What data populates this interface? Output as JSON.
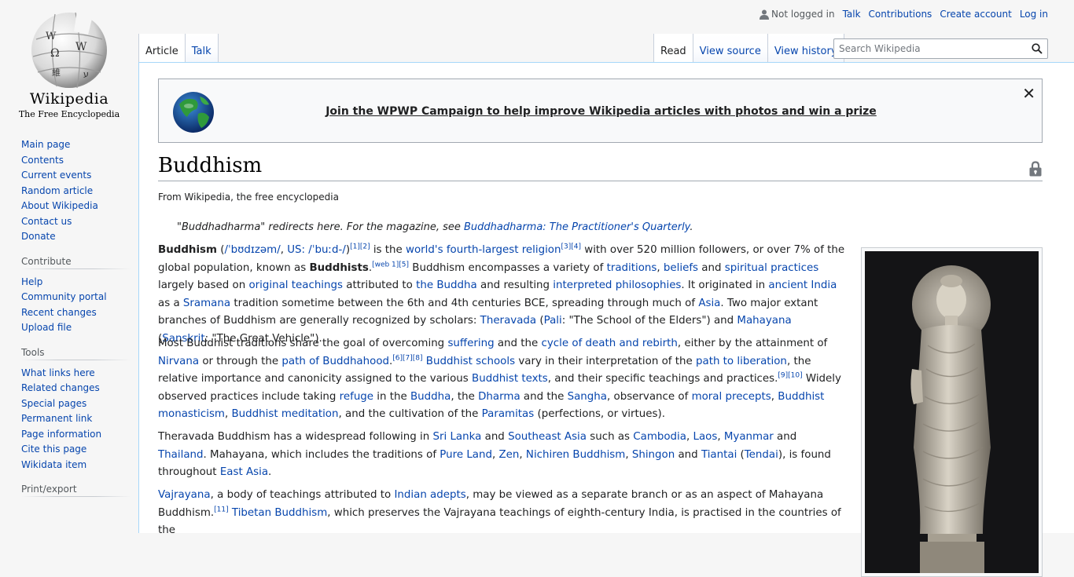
{
  "logo": {
    "wordmark": "Wikipedia",
    "tagline": "The Free Encyclopedia"
  },
  "personal": {
    "not_logged_in": "Not logged in",
    "talk": "Talk",
    "contributions": "Contributions",
    "create_account": "Create account",
    "log_in": "Log in"
  },
  "tabs": {
    "article": "Article",
    "talk": "Talk",
    "read": "Read",
    "view_source": "View source",
    "view_history": "View history"
  },
  "search": {
    "placeholder": "Search Wikipedia"
  },
  "sidebar": {
    "nav": [
      "Main page",
      "Contents",
      "Current events",
      "Random article",
      "About Wikipedia",
      "Contact us",
      "Donate"
    ],
    "contribute_heading": "Contribute",
    "contribute": [
      "Help",
      "Community portal",
      "Recent changes",
      "Upload file"
    ],
    "tools_heading": "Tools",
    "tools": [
      "What links here",
      "Related changes",
      "Special pages",
      "Permanent link",
      "Page information",
      "Cite this page",
      "Wikidata item"
    ],
    "print_heading": "Print/export"
  },
  "banner": {
    "text": "Join the WPWP Campaign to help improve Wikipedia articles with photos and win a prize",
    "close": "✕"
  },
  "article": {
    "title": "Buddhism",
    "tagline": "From Wikipedia, the free encyclopedia",
    "hatnote_prefix": "\"Buddhadharma\" redirects here. For the magazine, see ",
    "hatnote_link": "Buddhadharma: The Practitioner's Quarterly",
    "hatnote_suffix": ".",
    "p1": {
      "bold": "Buddhism",
      "ipa_open": " (",
      "ipa1": "/ˈbʊdɪzəm/",
      "ipa_sep": ", ",
      "us": "US:",
      "ipa2": " /ˈbuːd-/",
      "ipa_close": ")",
      "ref_a": "[1][2]",
      "t1": " is the ",
      "l1": "world's fourth-largest religion",
      "ref_b": "[3][4]",
      "t2": " with over 520 million followers, or over 7% of the global population, known as ",
      "bold2": "Buddhists",
      "t2b": ".",
      "ref_c": "[web 1][5]",
      "t3": " Buddhism encompasses a variety of ",
      "l2": "traditions",
      "t4": ", ",
      "l3": "beliefs",
      "t5": " and ",
      "l4": "spiritual practices",
      "t6": " largely based on ",
      "l5": "original teachings",
      "t7": " attributed to ",
      "l6": "the Buddha",
      "t8": " and resulting ",
      "l7": "interpreted philosophies",
      "t9": ". It originated in ",
      "l8": "ancient India",
      "t10": " as a ",
      "l9": "Sramana",
      "t11": " tradition sometime between the 6th and 4th centuries BCE, spreading through much of ",
      "l10": "Asia",
      "t12": ". Two major extant branches of Buddhism are generally recognized by scholars: ",
      "l11": "Theravada",
      "t13": " (",
      "l12": "Pali",
      "t14": ": \"The School of the Elders\") and ",
      "l13": "Mahayana",
      "t15": " (",
      "l14": "Sanskrit",
      "t16": ": \"The Great Vehicle\")."
    },
    "p2": {
      "t1": "Most Buddhist traditions share the goal of overcoming ",
      "l1": "suffering",
      "t2": " and the ",
      "l2": "cycle of death and rebirth",
      "t3": ", either by the attainment of ",
      "l3": "Nirvana",
      "t4": " or through the ",
      "l4": "path of Buddhahood",
      "t4b": ".",
      "ref_a": "[6][7][8]",
      "t5": " ",
      "l5": "Buddhist schools",
      "t6": " vary in their interpretation of the ",
      "l6": "path to liberation",
      "t7": ", the relative importance and canonicity assigned to the various ",
      "l7": "Buddhist texts",
      "t8": ", and their specific teachings and practices.",
      "ref_b": "[9][10]",
      "t9": " Widely observed practices include taking ",
      "l8": "refuge",
      "t10": " in the ",
      "l9": "Buddha",
      "t11": ", the ",
      "l10": "Dharma",
      "t12": " and the ",
      "l11": "Sangha",
      "t13": ", observance of ",
      "l12": "moral precepts",
      "t14": ", ",
      "l13": "Buddhist monasticism",
      "t15": ", ",
      "l14": "Buddhist meditation",
      "t16": ", and the cultivation of the ",
      "l15": "Paramitas",
      "t17": " (perfections, or virtues)."
    },
    "p3": {
      "t1": "Theravada Buddhism has a widespread following in ",
      "l1": "Sri Lanka",
      "t2": " and ",
      "l2": "Southeast Asia",
      "t3": " such as ",
      "l3": "Cambodia",
      "t4": ", ",
      "l4": "Laos",
      "t5": ", ",
      "l5": "Myanmar",
      "t6": " and ",
      "l6": "Thailand",
      "t7": ". Mahayana, which includes the traditions of ",
      "l7": "Pure Land",
      "t8": ", ",
      "l8": "Zen",
      "t9": ", ",
      "l9": "Nichiren Buddhism",
      "t10": ", ",
      "l10": "Shingon",
      "t11": " and ",
      "l11": "Tiantai",
      "t12": " (",
      "l12": "Tendai",
      "t13": "), is found throughout ",
      "l13": "East Asia",
      "t14": "."
    },
    "p4": {
      "l1": "Vajrayana",
      "t1": ", a body of teachings attributed to ",
      "l2": "Indian adepts",
      "t2": ", may be viewed as a separate branch or as an aspect of Mahayana Buddhism.",
      "ref_a": "[11]",
      "t3": " ",
      "l3": "Tibetan Buddhism",
      "t4": ", which preserves the Vajrayana teachings of eighth-century India, is practised in the countries of the"
    }
  }
}
